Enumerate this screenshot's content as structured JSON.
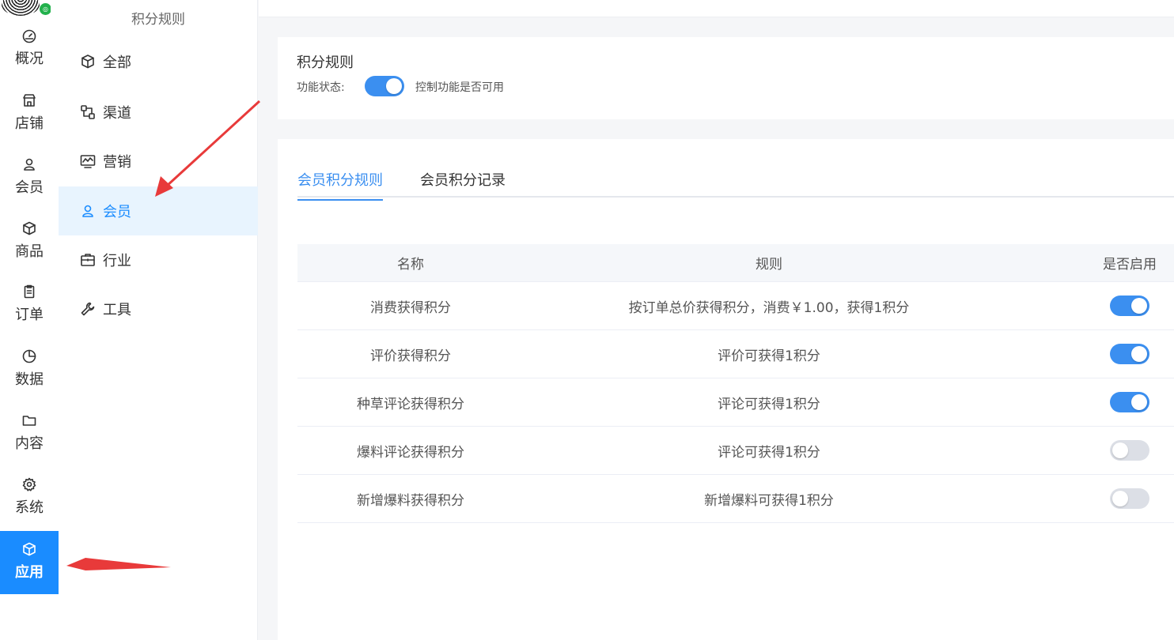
{
  "nav": {
    "items": [
      {
        "label": "概况",
        "icon": "dashboard-icon"
      },
      {
        "label": "店铺",
        "icon": "shop-icon"
      },
      {
        "label": "会员",
        "icon": "user-icon"
      },
      {
        "label": "商品",
        "icon": "box-icon"
      },
      {
        "label": "订单",
        "icon": "clipboard-icon"
      },
      {
        "label": "数据",
        "icon": "pie-chart-icon"
      },
      {
        "label": "内容",
        "icon": "folder-icon"
      },
      {
        "label": "系统",
        "icon": "gear-icon"
      },
      {
        "label": "应用",
        "icon": "cube-icon",
        "active": true
      }
    ]
  },
  "subnav": {
    "title": "积分规则",
    "items": [
      {
        "label": "全部",
        "icon": "cube-icon"
      },
      {
        "label": "渠道",
        "icon": "channel-icon"
      },
      {
        "label": "营销",
        "icon": "monitor-chart-icon"
      },
      {
        "label": "会员",
        "icon": "user-icon",
        "active": true
      },
      {
        "label": "行业",
        "icon": "briefcase-icon"
      },
      {
        "label": "工具",
        "icon": "wrench-icon"
      }
    ]
  },
  "header": {
    "title": "积分规则",
    "status_label": "功能状态:",
    "status_on": true,
    "status_desc": "控制功能是否可用"
  },
  "tabs": [
    {
      "label": "会员积分规则",
      "active": true
    },
    {
      "label": "会员积分记录",
      "active": false
    }
  ],
  "table": {
    "columns": [
      "名称",
      "规则",
      "是否启用"
    ],
    "rows": [
      {
        "name": "消费获得积分",
        "rule": "按订单总价获得积分，消费￥1.00，获得1积分",
        "enabled": true
      },
      {
        "name": "评价获得积分",
        "rule": "评价可获得1积分",
        "enabled": true
      },
      {
        "name": "种草评论获得积分",
        "rule": "评论可获得1积分",
        "enabled": true
      },
      {
        "name": "爆料评论获得积分",
        "rule": "评论可获得1积分",
        "enabled": false
      },
      {
        "name": "新增爆料获得积分",
        "rule": "新增爆料可获得1积分",
        "enabled": false
      }
    ]
  },
  "colors": {
    "accent": "#1a8cff",
    "toggle_on": "#3b8ff0",
    "toggle_off": "#dcdfe6",
    "annotation": "#e83a3a"
  }
}
